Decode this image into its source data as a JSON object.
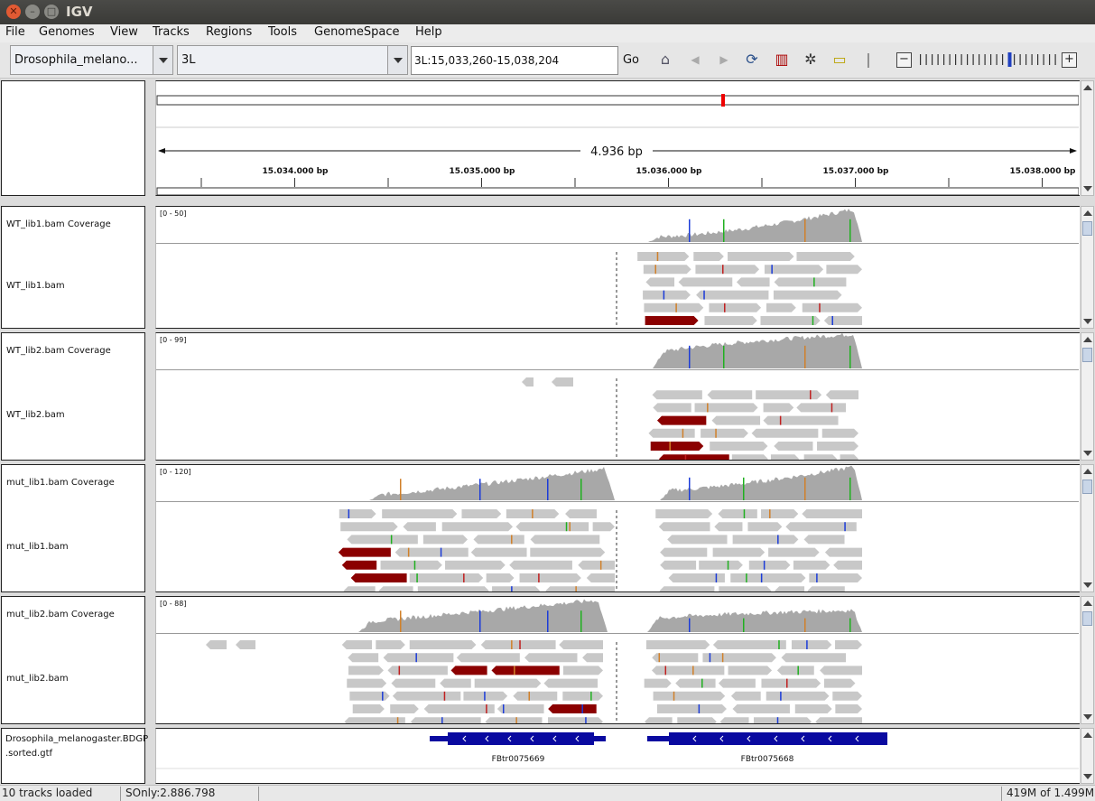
{
  "window": {
    "title": "IGV"
  },
  "menu": [
    "File",
    "Genomes",
    "View",
    "Tracks",
    "Regions",
    "Tools",
    "GenomeSpace",
    "Help"
  ],
  "toolbar": {
    "genome": "Drosophila_melano...",
    "chromosome": "3L",
    "locus": "3L:15,033,260-15,038,204",
    "go_label": "Go",
    "zoom_minus": "−",
    "zoom_plus": "+"
  },
  "ruler": {
    "span_label": "4.936 bp",
    "ticks": [
      "15.034.000 bp",
      "15.035.000 bp",
      "15.036.000 bp",
      "15.037.000 bp",
      "15.038.000 bp"
    ]
  },
  "tracks": [
    {
      "coverage_name": "WT_lib1.bam Coverage",
      "range": "[0 - 50]",
      "bam_name": "WT_lib1.bam"
    },
    {
      "coverage_name": "WT_lib2.bam Coverage",
      "range": "[0 - 99]",
      "bam_name": "WT_lib2.bam"
    },
    {
      "coverage_name": "mut_lib1.bam Coverage",
      "range": "[0 - 120]",
      "bam_name": "mut_lib1.bam"
    },
    {
      "coverage_name": "mut_lib2.bam Coverage",
      "range": "[0 - 88]",
      "bam_name": "mut_lib2.bam"
    }
  ],
  "annotation": {
    "name_line1": "Drosophila_melanogaster.BDGP",
    "name_line2": ".sorted.gtf",
    "features": [
      "FBtr0075669",
      "FBtr0075668"
    ]
  },
  "status": {
    "tracks_loaded": "10 tracks loaded",
    "position": "SOnly:2.886.798",
    "memory": "419M of 1.499M"
  },
  "colors": {
    "read": "#c8c8c8",
    "coverage": "#a8a8a8",
    "mismatch_red": "#8b0000",
    "gene": "#0a0aa0"
  }
}
